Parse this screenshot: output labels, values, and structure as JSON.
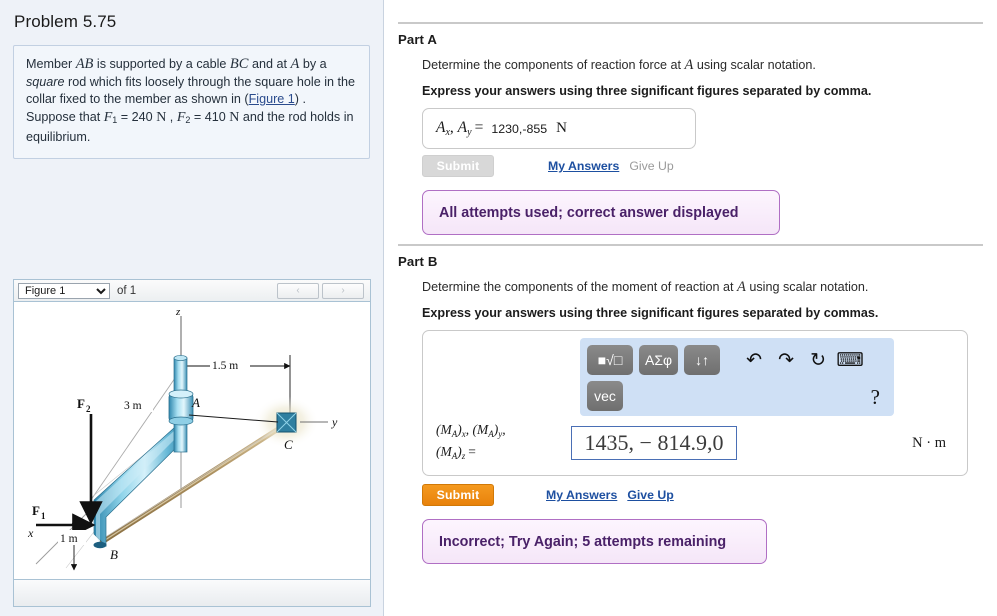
{
  "problem": {
    "title": "Problem 5.75",
    "statement_parts": {
      "t1": "Member ",
      "m1": "AB",
      "t2": " is supported by a cable ",
      "m2": "BC",
      "t3": " and at ",
      "m3": "A",
      "t4": " by a ",
      "em1": "square",
      "t5": " rod which fits loosely through the square hole in the collar fixed to the member as shown in (",
      "link": "Figure 1",
      "t6": ") . Suppose that ",
      "f1": "F",
      "f1sub": "1",
      "t7": " = 240 ",
      "u1": "N",
      "t8": " , ",
      "f2": "F",
      "f2sub": "2",
      "t9": " = 410 ",
      "u2": "N",
      "t10": " and the rod holds in equilibrium."
    }
  },
  "figure": {
    "select_value": "Figure 1",
    "options": [
      "Figure 1"
    ],
    "of_label": "of 1",
    "prev_label": "‹",
    "next_label": "›",
    "labels": {
      "z": "z",
      "y": "y",
      "x": "x",
      "A": "A",
      "B": "B",
      "C": "C",
      "F1": "F",
      "F1sub": "1",
      "F2": "F",
      "F2sub": "2",
      "dim_15": "1.5 m",
      "dim_3": "3 m",
      "dim_1": "1 m"
    }
  },
  "partA": {
    "heading": "Part A",
    "prompt_pre": "Determine the components of reaction force at ",
    "prompt_var": "A",
    "prompt_post": " using scalar notation.",
    "instruction": "Express your answers using three significant figures separated by comma.",
    "lhs": {
      "a": "A",
      "asub": "x",
      "b": "A",
      "bsub": "y",
      "eq": "="
    },
    "value": "1230,-855",
    "unit": "N",
    "submit_label": "Submit",
    "my_answers_label": "My Answers",
    "give_up_label": "Give Up",
    "feedback": "All attempts used; correct answer displayed"
  },
  "partB": {
    "heading": "Part B",
    "prompt_pre": "Determine the components of the moment of reaction at ",
    "prompt_var": "A",
    "prompt_post": " using scalar notation.",
    "instruction": "Express your answers using three significant figures separated by commas.",
    "lhs": {
      "l1a": "(M",
      "l1asub": "A",
      "l1b": ")",
      "l1bsub": "x",
      "l1c": ", (M",
      "l1csub": "A",
      "l1d": ")",
      "l1dsub": "y",
      "l1e": ",",
      "l2a": "(M",
      "l2asub": "A",
      "l2b": ")",
      "l2bsub": "z",
      "eq": "="
    },
    "value": "1435, − 814.9,0",
    "unit": "N · m",
    "submit_label": "Submit",
    "my_answers_label": "My Answers",
    "give_up_label": "Give Up",
    "feedback": "Incorrect; Try Again; 5 attempts remaining",
    "toolbar": {
      "template_label": "■√□",
      "greek_label": "ΑΣφ",
      "updown_label": "↓↑",
      "undo_label": "↶",
      "redo_label": "↷",
      "reset_label": "↻",
      "keyboard_label": "⌨",
      "vec_label": "vec",
      "help_label": "?"
    }
  },
  "colors": {
    "accent_orange": "#e8820c",
    "link_blue": "#1d4fa0",
    "feedback_border": "#b06fc4",
    "feedback_text": "#4a2168",
    "panel_bg": "#eef2f8",
    "toolbar_bg": "#cfe0f5",
    "rod_blue": "#3d9fc4",
    "cable_tan": "#b59a6a"
  }
}
